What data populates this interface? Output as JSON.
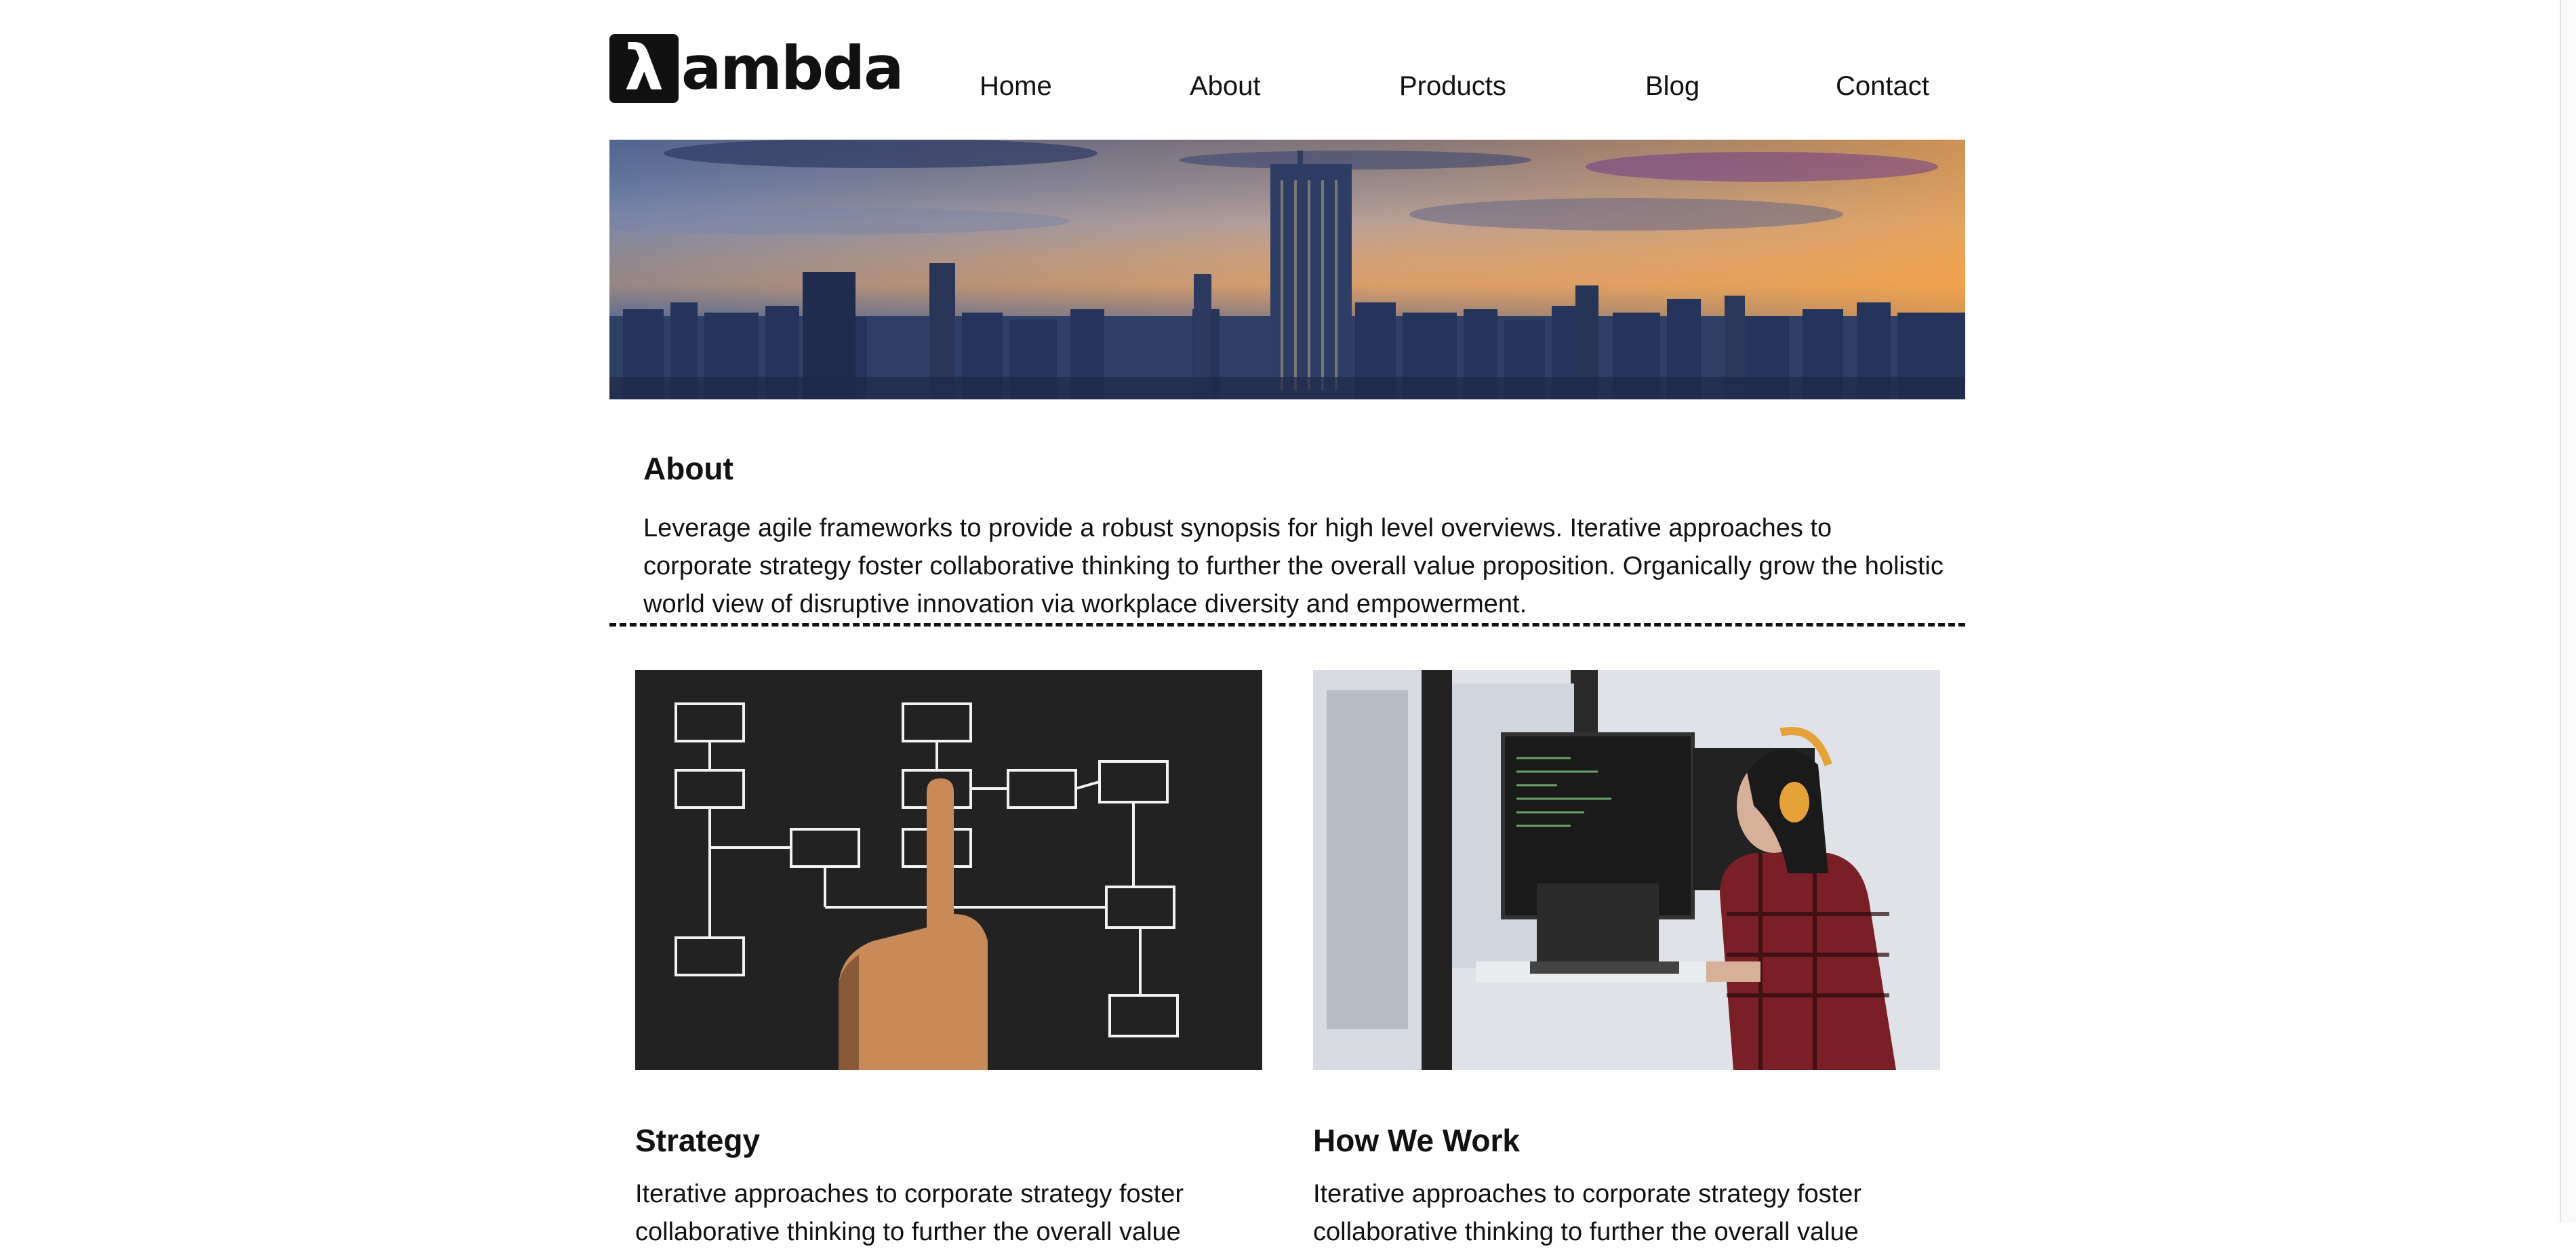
{
  "header": {
    "logo": {
      "mark": "λ",
      "text": "ambda"
    },
    "nav": [
      "Home",
      "About",
      "Products",
      "Blog",
      "Contact"
    ]
  },
  "about": {
    "title": "About",
    "text": "Leverage agile frameworks to provide a robust synopsis for high level overviews. Iterative approaches to corporate strategy foster collaborative thinking to further the overall value proposition. Organically grow the holistic world view of disruptive innovation via workplace diversity and empowerment."
  },
  "cards": [
    {
      "title": "Strategy",
      "text": "Iterative approaches to corporate strategy foster collaborative thinking to further the overall value"
    },
    {
      "title": "How We Work",
      "text": "Iterative approaches to corporate strategy foster collaborative thinking to further the overall value"
    }
  ]
}
